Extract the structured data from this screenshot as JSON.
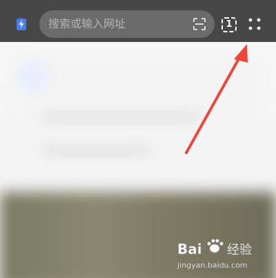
{
  "toolbar": {
    "search": {
      "placeholder": "搜索或输入网址"
    },
    "tabs_count": "1",
    "icons": {
      "app": "lightning-shield-icon",
      "scan": "scan-icon",
      "tabs": "tabs-icon",
      "menu": "four-dots-menu-icon"
    }
  },
  "watermark": {
    "brand_left": "Bai",
    "brand_right": "经验",
    "url": "jingyan.baidu.com"
  },
  "colors": {
    "toolbar_bg": "#474747",
    "search_bg": "#6b6b6b",
    "app_icon": "#4a7cf7",
    "annotation_arrow": "#f0443c"
  }
}
